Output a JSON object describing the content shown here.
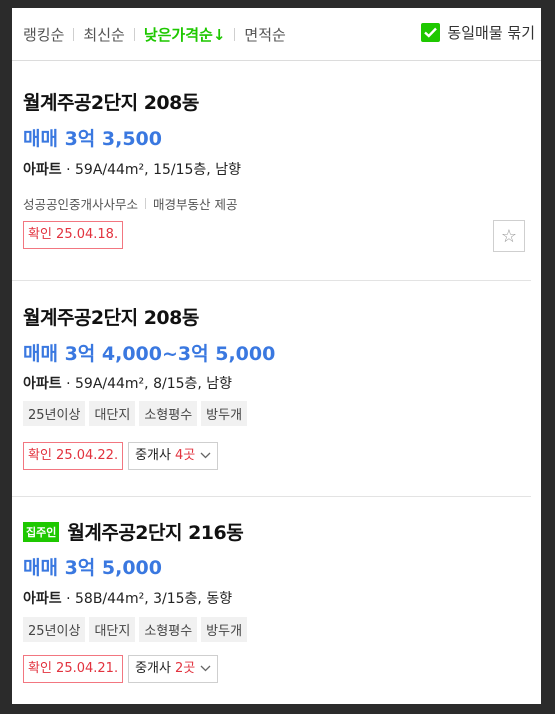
{
  "sort": {
    "items": [
      {
        "label": "랭킹순",
        "active": false
      },
      {
        "label": "최신순",
        "active": false
      },
      {
        "label": "낮은가격순↓",
        "active": true
      },
      {
        "label": "면적순",
        "active": false
      }
    ],
    "same_owner_label": "동일매물 묶기",
    "same_owner_checked": true
  },
  "listings": [
    {
      "title": "월계주공2단지 208동",
      "price": "매매 3억 3,500",
      "type": "아파트",
      "spec": "59A/44m², 15/15층, 남향",
      "agency": "성공공인중개사사무소",
      "provider": "매경부동산 제공",
      "confirm": "확인 25.04.18."
    },
    {
      "title": "월계주공2단지 208동",
      "price": "매매 3억 4,000~3억 5,000",
      "type": "아파트",
      "spec": "59A/44m², 8/15층, 남향",
      "tags": [
        "25년이상",
        "대단지",
        "소형평수",
        "방두개"
      ],
      "confirm": "확인 25.04.22.",
      "agents_label": "중개사",
      "agents_count": "4곳"
    },
    {
      "badge": "집주인",
      "title": "월계주공2단지 216동",
      "price": "매매 3억 5,000",
      "type": "아파트",
      "spec": "58B/44m², 3/15층, 동향",
      "tags": [
        "25년이상",
        "대단지",
        "소형평수",
        "방두개"
      ],
      "confirm": "확인 25.04.21.",
      "agents_label": "중개사",
      "agents_count": "2곳"
    }
  ],
  "colors": {
    "accent": "#1ec800",
    "price": "#3a78e0",
    "confirm": "#e2323e"
  }
}
